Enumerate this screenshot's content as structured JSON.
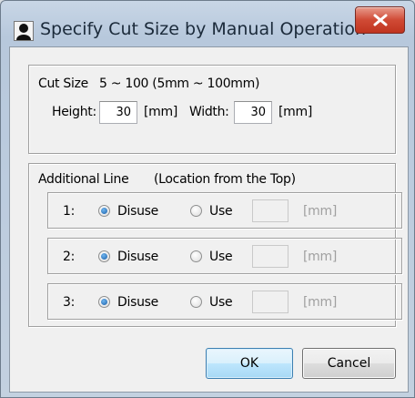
{
  "window": {
    "title": "Specify Cut Size by Manual Operation"
  },
  "cut_size": {
    "label": "Cut Size",
    "range": "5 ~ 100 (5mm ~ 100mm)",
    "height_label": "Height:",
    "height_value": "30",
    "height_unit": "[mm]",
    "width_label": "Width:",
    "width_value": "30",
    "width_unit": "[mm]"
  },
  "additional_line": {
    "label": "Additional Line",
    "hint": "(Location from the Top)",
    "rows": [
      {
        "index": "1:",
        "disuse_label": "Disuse",
        "use_label": "Use",
        "unit": "[mm]",
        "selected": "Disuse",
        "value": ""
      },
      {
        "index": "2:",
        "disuse_label": "Disuse",
        "use_label": "Use",
        "unit": "[mm]",
        "selected": "Disuse",
        "value": ""
      },
      {
        "index": "3:",
        "disuse_label": "Disuse",
        "use_label": "Use",
        "unit": "[mm]",
        "selected": "Disuse",
        "value": ""
      }
    ]
  },
  "buttons": {
    "ok": "OK",
    "cancel": "Cancel"
  },
  "colors": {
    "accent": "#3c7fb1",
    "close_button": "#c0341f",
    "dialog_background": "#f0f0f0"
  },
  "icons": {
    "app": "person-silhouette-icon",
    "close": "close-icon"
  }
}
